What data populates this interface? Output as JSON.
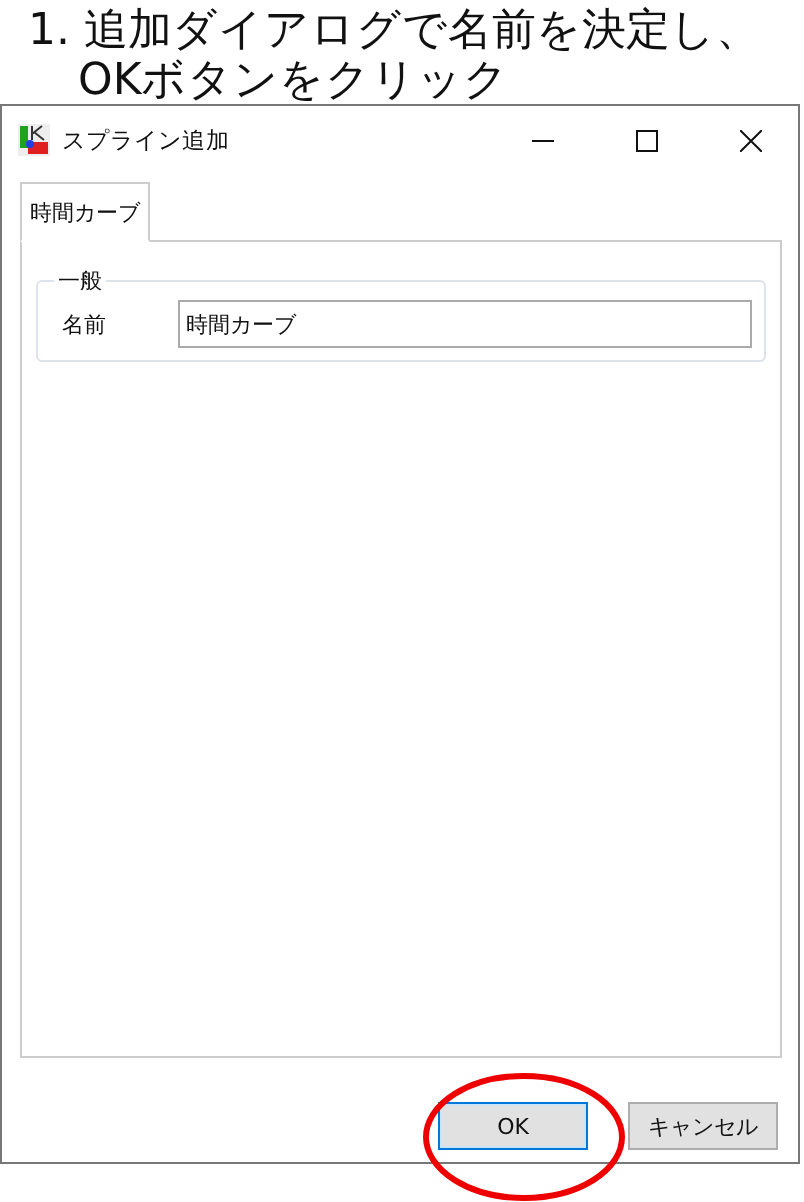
{
  "caption": {
    "lines": [
      "1. 追加ダイアログで名前を決定し、",
      "OKボタンをクリック"
    ]
  },
  "window": {
    "title": "スプライン追加"
  },
  "tabs": [
    {
      "label": "時間カーブ",
      "selected": true
    }
  ],
  "group": {
    "title": "一般",
    "fields": [
      {
        "label": "名前",
        "value": "時間カーブ"
      }
    ]
  },
  "buttons": [
    {
      "label": "OK",
      "default": true,
      "highlighted": true
    },
    {
      "label": "キャンセル",
      "default": false,
      "highlighted": false
    }
  ]
}
